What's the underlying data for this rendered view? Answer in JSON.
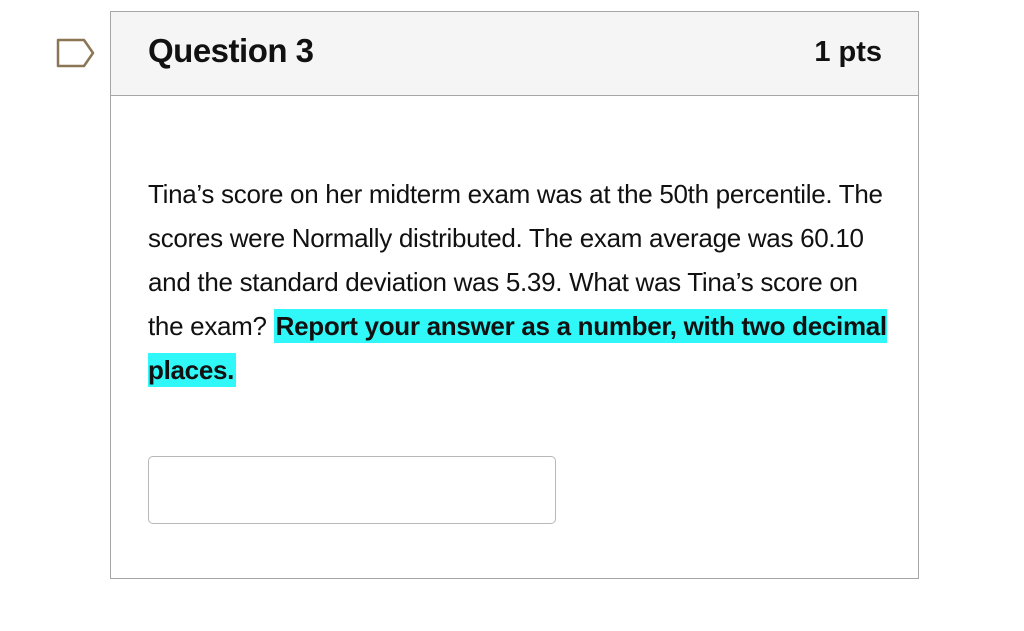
{
  "question": {
    "title": "Question 3",
    "points": "1 pts",
    "text_before_highlight": "Tina’s score on her midterm exam was at the 50th percentile. The scores were Normally distributed. The exam average was 60.10 and the standard deviation was 5.39. What was Tina’s score on the exam? ",
    "text_highlight": "Report your answer as a number, with two decimal places.",
    "answer": {
      "value": "",
      "placeholder": ""
    }
  },
  "colors": {
    "flag_outline": "#8a7555",
    "highlight": "#31f8f8",
    "header_bg": "#f5f5f5",
    "border": "#a6a6a6"
  },
  "icons": {
    "flag": "flag-question-icon"
  }
}
